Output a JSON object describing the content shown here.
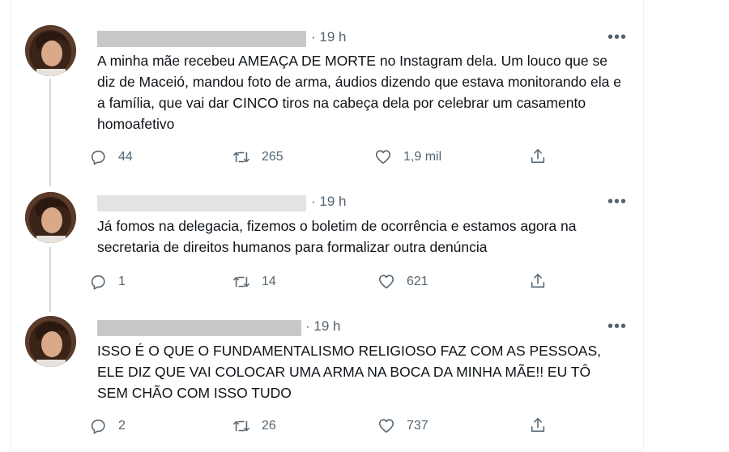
{
  "tweets": [
    {
      "time": "· 19 h",
      "text": "A minha mãe recebeu AMEAÇA DE MORTE no Instagram dela. Um louco que se diz de Maceió, mandou foto de arma, áudios dizendo que estava monitorando ela e a família, que vai dar CINCO tiros na cabeça dela por celebrar um casamento homoafetivo",
      "replies": "44",
      "retweets": "265",
      "likes": "1,9 mil"
    },
    {
      "time": "· 19 h",
      "text": "Já fomos na delegacia, fizemos o boletim de ocorrência e estamos agora na secretaria de direitos humanos para formalizar outra denúncia",
      "replies": "1",
      "retweets": "14",
      "likes": "621"
    },
    {
      "time": "· 19 h",
      "text": "ISSO É O QUE O FUNDAMENTALISMO RELIGIOSO FAZ COM AS PESSOAS, ELE DIZ QUE VAI COLOCAR UMA ARMA NA BOCA DA MINHA MÃE!! EU TÔ SEM CHÃO COM ISSO TUDO",
      "replies": "2",
      "retweets": "26",
      "likes": "737"
    }
  ],
  "more_label": "•••",
  "icons": {
    "reply": "reply-icon",
    "retweet": "retweet-icon",
    "like": "heart-icon",
    "share": "share-icon",
    "more": "more-icon"
  },
  "colors": {
    "text": "#0f1419",
    "secondary": "#536471",
    "line": "#cfd9de",
    "redaction": "#c8c8c8"
  }
}
